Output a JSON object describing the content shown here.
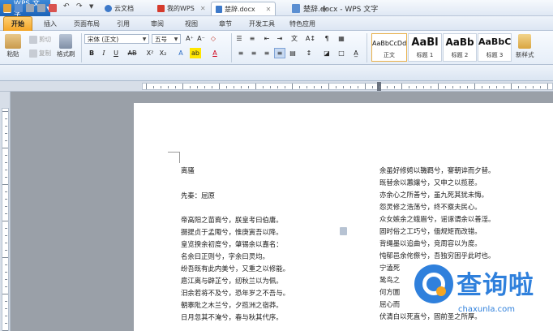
{
  "app": {
    "name": "WPS 文字",
    "window_title": "楚辞.docx - WPS 文字"
  },
  "menu_tabs": [
    "开始",
    "插入",
    "页面布局",
    "引用",
    "审阅",
    "视图",
    "章节",
    "开发工具",
    "特色应用"
  ],
  "ribbon": {
    "paste": "粘贴",
    "cut": "剪切",
    "copy": "复制",
    "format_painter": "格式刷",
    "font_name": "宋体 (正文)",
    "font_size": "五号",
    "styles": [
      {
        "preview": "AaBbCcDd",
        "name": "正文"
      },
      {
        "preview": "AaBl",
        "name": "标题 1"
      },
      {
        "preview": "AaBb",
        "name": "标题 2"
      },
      {
        "preview": "AaBbC",
        "name": "标题 3"
      }
    ],
    "new_style": "新样式"
  },
  "doc_tabs": [
    "云文档",
    "我的WPS",
    "楚辞.docx"
  ],
  "document": {
    "left_column": [
      "离骚",
      "",
      "先秦：屈原",
      "",
      "帝高阳之苗裔兮，朕皇考曰伯庸。",
      "摄提贞于孟陬兮，惟庚寅吾以降。",
      "皇览揆余初度兮，肇锡余以嘉名：",
      "名余曰正则兮，字余曰灵均。",
      "纷吾既有此内美兮，又重之以修能。",
      "扈江离与辟芷兮，纫秋兰以为佩。",
      "汨余若将不及兮，恐年岁之不吾与。",
      "朝搴阰之木兰兮，夕揽洲之宿莽。",
      "日月忽其不淹兮，春与秋其代序。"
    ],
    "right_column": [
      "余虽好修姱以鞿羁兮，謇朝谇而夕替。",
      "既替余以蕙纕兮，又申之以揽茝。",
      "亦余心之所善兮，虽九死其犹未悔。",
      "怨灵修之浩荡兮，终不察夫民心。",
      "众女嫉余之蛾眉兮，谣诼谓余以善淫。",
      "固时俗之工巧兮，偭规矩而改错。",
      "背绳墨以追曲兮，竞周容以为度。",
      "忳郁邑余侘傺兮，吾独穷困乎此时也。",
      "宁溘死",
      "鸷鸟之",
      "何方圜",
      "屈心而",
      "伏清白以死直兮，固前圣之所厚。"
    ]
  },
  "watermark": {
    "text": "查询啦",
    "url": "chaxunla.com"
  }
}
